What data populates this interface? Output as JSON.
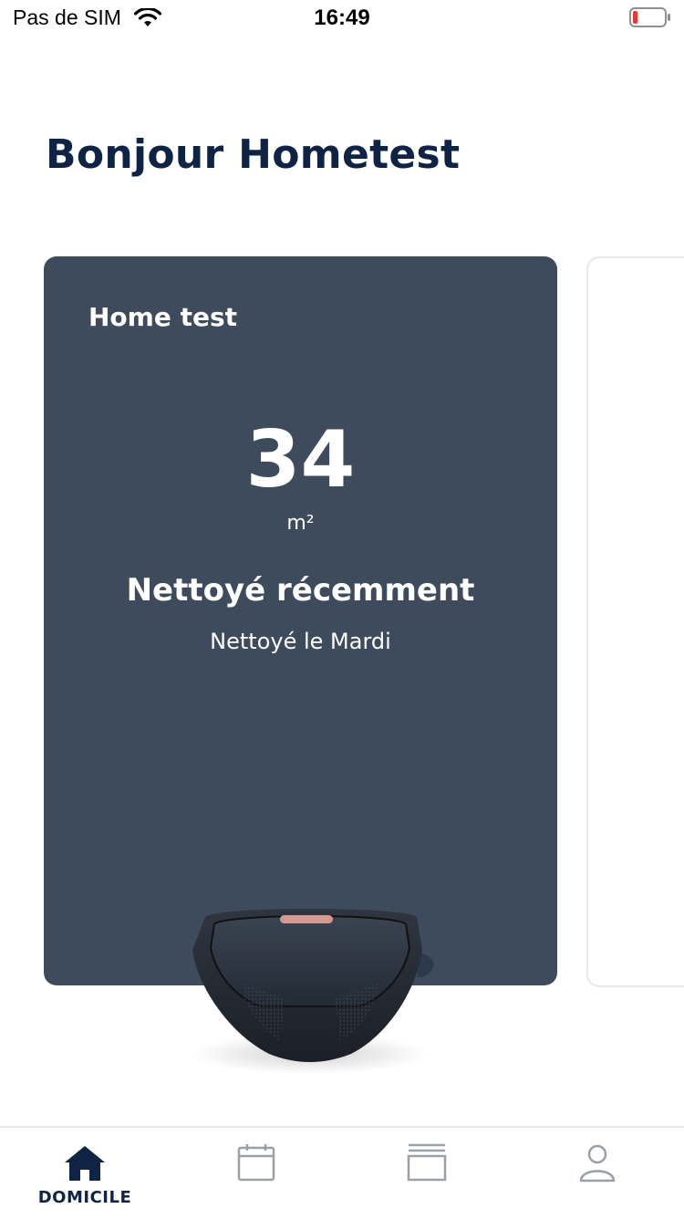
{
  "status_bar": {
    "carrier": "Pas de SIM",
    "time": "16:49",
    "battery_level": 0.12,
    "battery_color": "#e53935"
  },
  "greeting": "Bonjour Hometest",
  "home_card": {
    "title": "Home test",
    "area_value": "34",
    "area_unit": "m²",
    "status": "Nettoyé récemment",
    "last_cleaned": "Nettoyé le Mardi",
    "background_color": "#3e4b5c"
  },
  "tab_bar": {
    "tabs": [
      {
        "id": "home",
        "icon": "home-icon",
        "label": "DOMICILE",
        "active": true
      },
      {
        "id": "calendar",
        "icon": "calendar-icon",
        "label": "",
        "active": false
      },
      {
        "id": "history",
        "icon": "stack-icon",
        "label": "",
        "active": false
      },
      {
        "id": "profile",
        "icon": "user-icon",
        "label": "",
        "active": false
      }
    ],
    "active_color": "#0f2444",
    "inactive_color": "#9aa0a8"
  }
}
